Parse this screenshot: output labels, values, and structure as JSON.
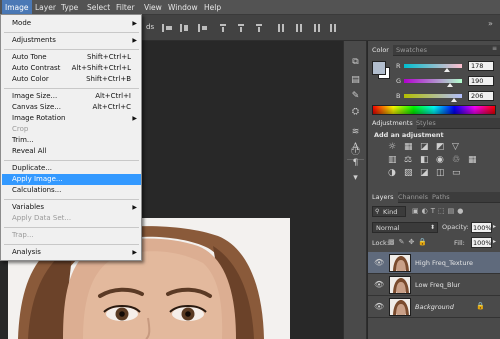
{
  "menubar": {
    "items": [
      "Image",
      "Layer",
      "Type",
      "Select",
      "Filter",
      "View",
      "Window",
      "Help"
    ]
  },
  "options_bar": {
    "fragment": "ds"
  },
  "image_menu": {
    "items": [
      {
        "label": "Mode",
        "shortcut": "",
        "submenu": true,
        "disabled": false
      },
      {
        "label": "Adjustments",
        "shortcut": "",
        "submenu": true,
        "disabled": false
      },
      {
        "label": "Auto Tone",
        "shortcut": "Shift+Ctrl+L",
        "submenu": false,
        "disabled": false
      },
      {
        "label": "Auto Contrast",
        "shortcut": "Alt+Shift+Ctrl+L",
        "submenu": false,
        "disabled": false
      },
      {
        "label": "Auto Color",
        "shortcut": "Shift+Ctrl+B",
        "submenu": false,
        "disabled": false
      },
      {
        "label": "Image Size...",
        "shortcut": "Alt+Ctrl+I",
        "submenu": false,
        "disabled": false
      },
      {
        "label": "Canvas Size...",
        "shortcut": "Alt+Ctrl+C",
        "submenu": false,
        "disabled": false
      },
      {
        "label": "Image Rotation",
        "shortcut": "",
        "submenu": true,
        "disabled": false
      },
      {
        "label": "Crop",
        "shortcut": "",
        "submenu": false,
        "disabled": true
      },
      {
        "label": "Trim...",
        "shortcut": "",
        "submenu": false,
        "disabled": false
      },
      {
        "label": "Reveal All",
        "shortcut": "",
        "submenu": false,
        "disabled": false
      },
      {
        "label": "Duplicate...",
        "shortcut": "",
        "submenu": false,
        "disabled": false
      },
      {
        "label": "Apply Image...",
        "shortcut": "",
        "submenu": false,
        "disabled": false
      },
      {
        "label": "Calculations...",
        "shortcut": "",
        "submenu": false,
        "disabled": false
      },
      {
        "label": "Variables",
        "shortcut": "",
        "submenu": true,
        "disabled": false
      },
      {
        "label": "Apply Data Set...",
        "shortcut": "",
        "submenu": false,
        "disabled": true
      },
      {
        "label": "Trap...",
        "shortcut": "",
        "submenu": false,
        "disabled": true
      },
      {
        "label": "Analysis",
        "shortcut": "",
        "submenu": true,
        "disabled": false
      }
    ]
  },
  "color_panel": {
    "tabs": [
      "Color",
      "Swatches"
    ],
    "channels": [
      {
        "label": "R",
        "value": "178",
        "fraction": 0.7
      },
      {
        "label": "G",
        "value": "190",
        "fraction": 0.75
      },
      {
        "label": "B",
        "value": "206",
        "fraction": 0.81
      }
    ],
    "foreground": "#b2bece",
    "background": "#ffffff"
  },
  "adjustments_panel": {
    "tabs": [
      "Adjustments",
      "Styles"
    ],
    "heading": "Add an adjustment"
  },
  "layers_panel": {
    "tabs": [
      "Layers",
      "Channels",
      "Paths"
    ],
    "filter_kind": "Kind",
    "blend_mode": "Normal",
    "opacity_label": "Opacity:",
    "opacity_value": "100%",
    "lock_label": "Lock:",
    "fill_label": "Fill:",
    "fill_value": "100%",
    "layers": [
      {
        "name": "High Freq_Texture",
        "selected": true,
        "italic": false
      },
      {
        "name": "Low Freq_Blur",
        "selected": false,
        "italic": false
      },
      {
        "name": "Background",
        "selected": false,
        "italic": true
      }
    ]
  },
  "colors": {
    "menu_highlight": "#3399ff",
    "menubar_active": "#4b79b6",
    "layer_selected": "#5f6a7c"
  }
}
